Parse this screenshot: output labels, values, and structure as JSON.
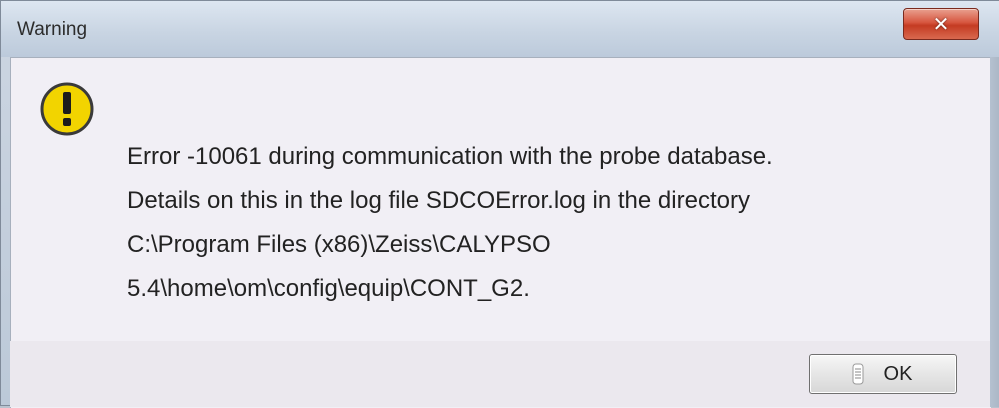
{
  "window": {
    "title": "Warning",
    "close_glyph": "✕"
  },
  "message": {
    "icon": "warning-icon",
    "lines": [
      "Error -10061 during communication with the probe database.",
      "Details on this in the log file SDCOError.log in the directory",
      "C:\\Program Files (x86)\\Zeiss\\CALYPSO",
      "5.4\\home\\om\\config\\equip\\CONT_G2."
    ]
  },
  "buttons": {
    "ok_label": "OK"
  },
  "colors": {
    "warning_yellow": "#f2d400",
    "close_red": "#c9442b"
  }
}
